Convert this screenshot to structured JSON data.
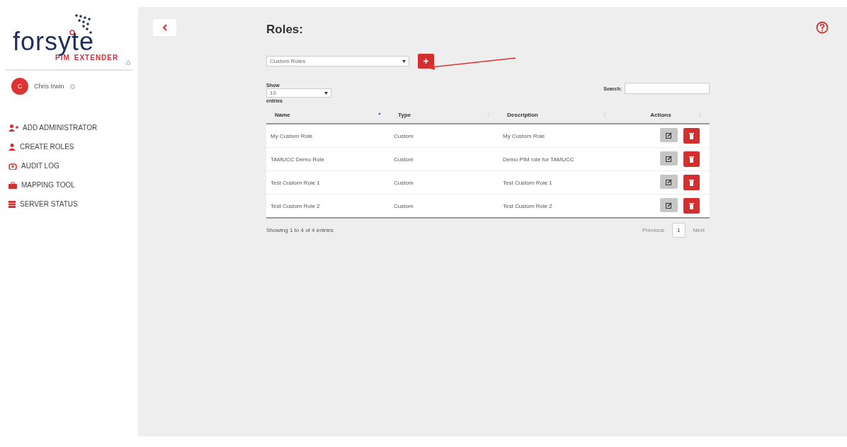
{
  "logo": {
    "wordmark": "forsyte",
    "tagline_left": "PIM",
    "tagline_right": "EXTENDER"
  },
  "user": {
    "initial": "C",
    "name": "Chris Irwin"
  },
  "nav": [
    {
      "label": "ADD ADMINISTRATOR",
      "kind": "user-plus"
    },
    {
      "label": "CREATE ROLES",
      "kind": "user"
    },
    {
      "label": "AUDIT LOG",
      "kind": "audit"
    },
    {
      "label": "MAPPING TOOL",
      "kind": "toolbox"
    },
    {
      "label": "SERVER STATUS",
      "kind": "server"
    }
  ],
  "page": {
    "title": "Roles:"
  },
  "role_filter": {
    "value": "Custom Roles"
  },
  "length": {
    "label_before": "Show",
    "value": "10",
    "label_after": "entries"
  },
  "search": {
    "label": "Search:"
  },
  "table": {
    "columns": [
      {
        "label": "Name",
        "sorted": true
      },
      {
        "label": "Type",
        "sorted": false
      },
      {
        "label": "Description",
        "sorted": false
      },
      {
        "label": "Actions",
        "sorted": false
      }
    ],
    "rows": [
      {
        "name": "My Custom Role",
        "type": "Custom",
        "description": "My Custom Role"
      },
      {
        "name": "TAMUCC Demo Role",
        "type": "Custom",
        "description": "Demo PIM role for TAMUCC"
      },
      {
        "name": "Test Custom Role 1",
        "type": "Custom",
        "description": "Test Custom Role 1"
      },
      {
        "name": "Test Custom Role 2",
        "type": "Custom",
        "description": "Test Custom Role 2"
      }
    ]
  },
  "footer": {
    "info": "Showing 1 to 4 of 4 entries",
    "pages": [
      {
        "label": "Previous",
        "selected": false
      },
      {
        "label": "1",
        "selected": true
      },
      {
        "label": "Next",
        "selected": false
      }
    ]
  }
}
